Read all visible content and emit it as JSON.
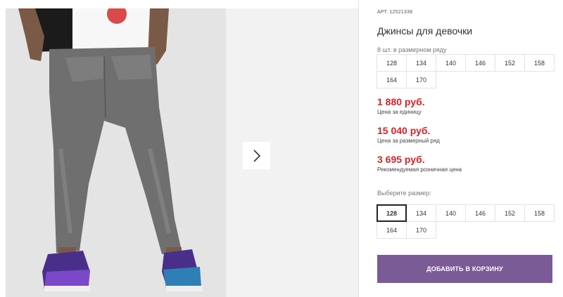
{
  "product": {
    "article_label": "АРТ.",
    "article_number": "12521338",
    "title": "Джинсы для девочки"
  },
  "size_pack": {
    "note": "8 шт. в размерном ряду",
    "sizes": [
      "128",
      "134",
      "140",
      "146",
      "152",
      "158",
      "164",
      "170"
    ]
  },
  "prices": {
    "unit_price": "1 880 руб.",
    "unit_caption": "Цена за единицу",
    "pack_price": "15 040 руб.",
    "pack_caption": "Цена за размерный ряд",
    "retail_price": "3 695 руб.",
    "retail_caption": "Рекомендуемая розничная цена"
  },
  "size_select": {
    "label": "Выберите размер:",
    "options": [
      "128",
      "134",
      "140",
      "146",
      "152",
      "158",
      "164",
      "170"
    ],
    "selected": "128"
  },
  "actions": {
    "add_to_cart": "ДОБАВИТЬ В КОРЗИНУ"
  },
  "gallery": {
    "next_icon": "chevron-right-icon"
  },
  "colors": {
    "price": "#d4232b",
    "button": "#7b5b96"
  }
}
